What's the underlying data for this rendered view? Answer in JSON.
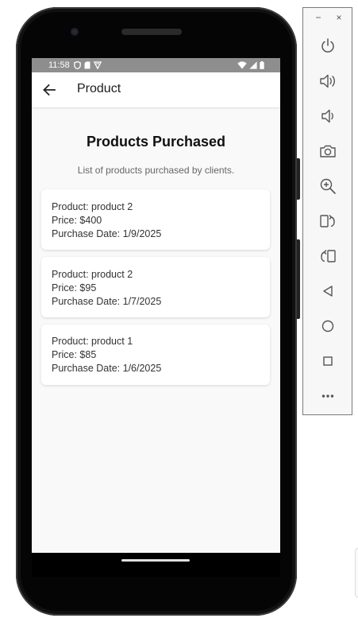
{
  "status_bar": {
    "time": "11:58"
  },
  "app_bar": {
    "title": "Product"
  },
  "main": {
    "heading": "Products Purchased",
    "subheading": "List of products purchased by clients.",
    "purchases": [
      {
        "product": "Product: product 2",
        "price": "Price: $400",
        "date": "Purchase Date: 1/9/2025"
      },
      {
        "product": "Product: product 2",
        "price": "Price: $95",
        "date": "Purchase Date: 1/7/2025"
      },
      {
        "product": "Product: product 1",
        "price": "Price: $85",
        "date": "Purchase Date: 1/6/2025"
      }
    ]
  },
  "emulator_toolbar": {
    "minimize_label": "−",
    "close_label": "×",
    "buttons": [
      "power-icon",
      "volume-up-icon",
      "volume-down-icon",
      "camera-icon",
      "zoom-icon",
      "rotate-left-icon",
      "rotate-right-icon",
      "back-icon",
      "home-icon",
      "overview-icon",
      "more-icon"
    ]
  },
  "colors": {
    "status_bar": "#8e8e8e",
    "screen_background": "#f9f9f9",
    "card_background": "#ffffff",
    "phone_body": "#1a1a1a"
  }
}
